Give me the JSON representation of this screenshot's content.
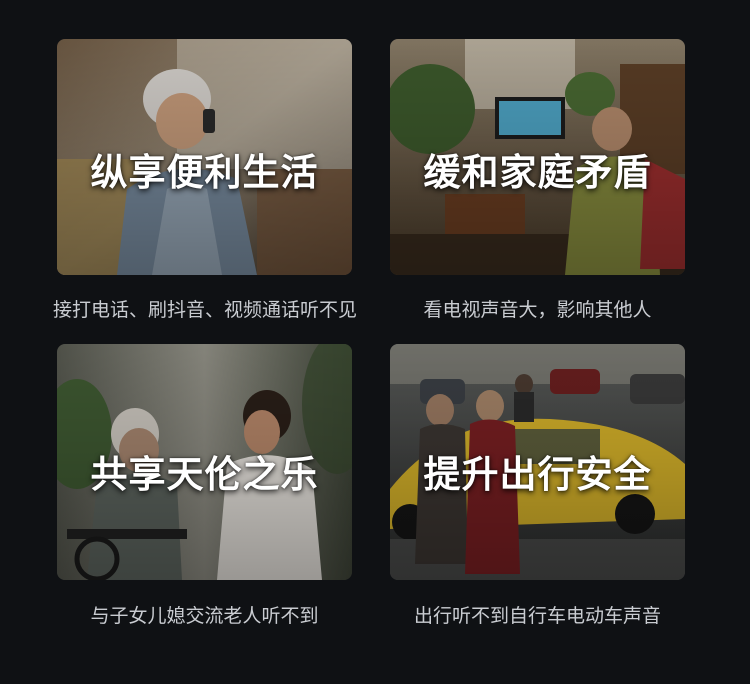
{
  "cards": [
    {
      "title": "纵享便利生活",
      "caption": "接打电话、刷抖音、视频通话听不见"
    },
    {
      "title": "缓和家庭矛盾",
      "caption": "看电视声音大，影响其他人"
    },
    {
      "title": "共享天伦之乐",
      "caption": "与子女儿媳交流老人听不到"
    },
    {
      "title": "提升出行安全",
      "caption": "出行听不到自行车电动车声音"
    }
  ],
  "colors": {
    "background": "#0f1114",
    "title_text": "#ffffff",
    "caption_text": "#c9ccd1"
  }
}
